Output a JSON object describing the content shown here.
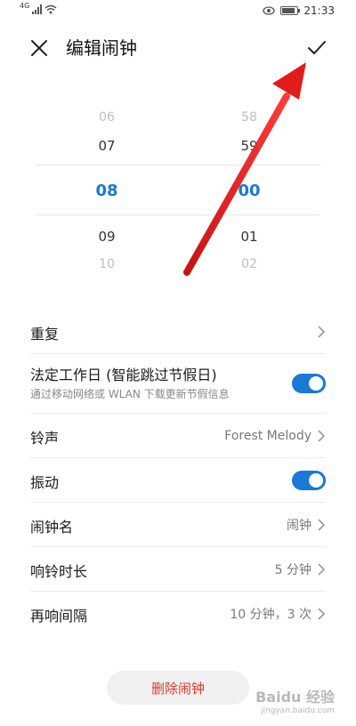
{
  "status_bar": {
    "signal_label": "4G",
    "time": "21:33",
    "icons": [
      "signal-icon",
      "wifi-icon",
      "eye-icon",
      "battery-icon"
    ]
  },
  "header": {
    "title": "编辑闹钟",
    "close_icon": "close-icon",
    "confirm_icon": "check-icon"
  },
  "picker": {
    "hours": [
      "06",
      "07",
      "08",
      "09",
      "10"
    ],
    "minutes": [
      "58",
      "59",
      "00",
      "01",
      "02"
    ],
    "selected_hour": "08",
    "selected_minute": "00",
    "accent_color": "#1a78d6"
  },
  "settings": {
    "repeat": {
      "label": "重复"
    },
    "workday": {
      "label": "法定工作日 (智能跳过节假日)",
      "sub": "通过移动网络或 WLAN 下载更新节假信息",
      "enabled": true
    },
    "ringtone": {
      "label": "铃声",
      "value": "Forest Melody"
    },
    "vibration": {
      "label": "振动",
      "enabled": true
    },
    "alarm_name": {
      "label": "闹钟名",
      "value": "闹钟"
    },
    "ring_duration": {
      "label": "响铃时长",
      "value": "5 分钟"
    },
    "snooze_interval": {
      "label": "再响间隔",
      "value": "10 分钟，3 次"
    }
  },
  "delete_button": {
    "label": "删除闹钟",
    "color": "#e0392b"
  },
  "watermark": {
    "main": "Baidu 经验",
    "sub": "jingyan.baidu.com"
  },
  "annotation_color": "#e21b1b"
}
